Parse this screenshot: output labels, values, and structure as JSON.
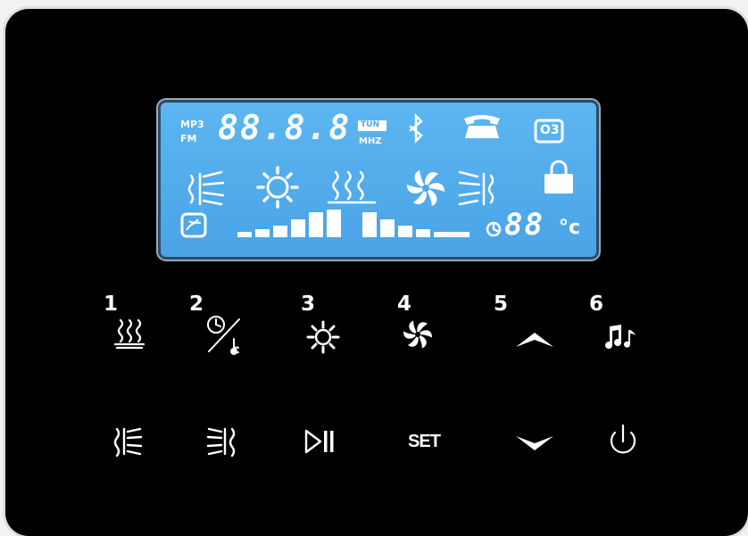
{
  "lcd": {
    "mp3_label": "MP3",
    "fm_label": "FM",
    "frequency_segments": "88.8.8",
    "tun_label": "TUN",
    "mhz_label": "MHZ",
    "ozone_label": "O3",
    "temperature_digits": "88",
    "celsius_label": "°c",
    "level_bars": 10,
    "background_color": "#4ea8ea"
  },
  "buttons": {
    "numbers": [
      "1",
      "2",
      "3",
      "4",
      "5",
      "6"
    ],
    "set_label": "SET"
  },
  "icons": [
    "steam-icon",
    "timer-temperature-icon",
    "light-icon",
    "fan-icon",
    "up-arrow-icon",
    "music-icon",
    "heat-left-icon",
    "heat-right-icon",
    "play-pause-icon",
    "set-icon",
    "down-arrow-icon",
    "power-icon"
  ]
}
